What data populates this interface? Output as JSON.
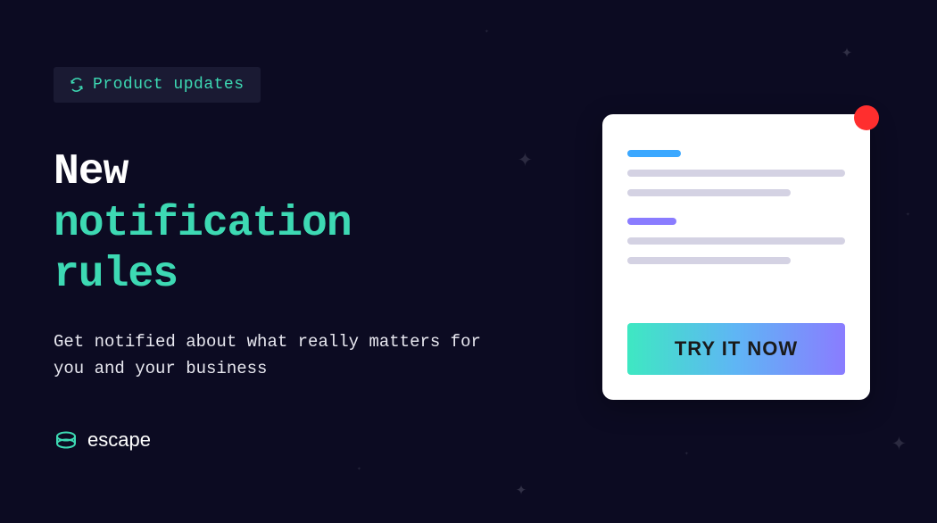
{
  "badge": {
    "label": "Product updates"
  },
  "heading": {
    "line1": "New",
    "line2": "notification",
    "line3": "rules"
  },
  "subtitle": "Get notified about what really matters for you and your business",
  "logo": {
    "text": "escape"
  },
  "cta": {
    "label": "TRY IT NOW"
  },
  "colors": {
    "accent": "#3dd9b3",
    "notification": "#ff2e2e",
    "gradient_start": "#3ee8c2",
    "gradient_end": "#8a7cff"
  }
}
